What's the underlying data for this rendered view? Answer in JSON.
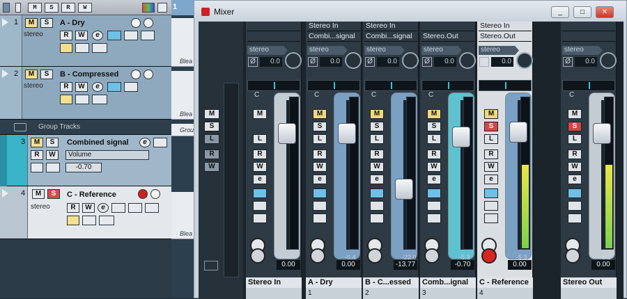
{
  "project": {
    "toolbar": [
      "M",
      "S",
      "R",
      "W"
    ],
    "tracks": [
      {
        "num": "1",
        "name": "A - Dry",
        "sub": "stereo",
        "m": "M",
        "s": "S",
        "r": "R",
        "w": "W",
        "e": "e"
      },
      {
        "num": "2",
        "name": "B - Compressed",
        "sub": "stereo",
        "m": "M",
        "s": "S",
        "r": "R",
        "w": "W",
        "e": "e"
      },
      {
        "folder": "Group Tracks"
      },
      {
        "num": "3",
        "name": "Combined signal",
        "param": "Volume",
        "value": "-0.70",
        "m": "M",
        "s": "S",
        "r": "R",
        "w": "W",
        "e": "e"
      },
      {
        "num": "4",
        "name": "C - Reference",
        "sub": "stereo",
        "m": "M",
        "s": "S",
        "r": "R",
        "w": "W",
        "e": "e"
      }
    ],
    "lanes": [
      "Blea",
      "Blea",
      "Grou",
      "Blea"
    ]
  },
  "mixer": {
    "title": "Mixer",
    "win_min": "_",
    "win_max": "□",
    "win_close": "✕",
    "strips": [
      {
        "routing": [
          "",
          ""
        ],
        "tag": "stereo",
        "gain": "0.0",
        "pan": "C",
        "buttons": [
          "M",
          "",
          "L",
          "R",
          "W",
          "e",
          "",
          "",
          ""
        ],
        "vol": "0.00",
        "peak": "-∞",
        "name": "Stereo In",
        "num": ""
      },
      {
        "routing": [
          "Stereo In",
          "Combi...signal"
        ],
        "tag": "stereo",
        "gain": "0.0",
        "pan": "C",
        "buttons": [
          "M",
          "S",
          "L",
          "R",
          "W",
          "e",
          "",
          "",
          ""
        ],
        "vol": "0.00",
        "peak": "-0.4",
        "name": "A - Dry",
        "num": "1"
      },
      {
        "routing": [
          "Stereo In",
          "Combi...signal"
        ],
        "tag": "stereo",
        "gain": "0.0",
        "pan": "C",
        "buttons": [
          "M",
          "S",
          "L",
          "R",
          "W",
          "e",
          "",
          "",
          ""
        ],
        "vol": "-13.77",
        "peak": "-22.0",
        "name": "B - C...essed",
        "num": "2"
      },
      {
        "routing": [
          "",
          "Stereo.Out"
        ],
        "tag": "stereo",
        "gain": "0.0",
        "pan": "C",
        "buttons": [
          "M",
          "S",
          "L",
          "R",
          "W",
          "e",
          "",
          "",
          ""
        ],
        "vol": "-0.70",
        "peak": "-5.3",
        "name": "Comb...ignal",
        "num": "3"
      },
      {
        "routing": [
          "Stereo In",
          "Stereo.Out"
        ],
        "tag": "stereo",
        "gain": "0.0",
        "pan": "C",
        "buttons": [
          "M",
          "S",
          "L",
          "R",
          "W",
          "e",
          "",
          "",
          ""
        ],
        "vol": "0.00",
        "peak": "-5.3",
        "name": "C - Reference",
        "num": "4"
      },
      {
        "routing": [
          "",
          ""
        ],
        "tag": "stereo",
        "gain": "0.0",
        "pan": "C",
        "buttons": [
          "M",
          "S",
          "L",
          "R",
          "W",
          "e",
          "",
          "",
          ""
        ],
        "vol": "0.00",
        "peak": "-5.3",
        "name": "Stereo Out",
        "num": ""
      }
    ],
    "left_buttons": [
      "M",
      "S",
      "L",
      "R",
      "W"
    ]
  },
  "colors": {
    "accent": "#36c3e0",
    "record": "#cc2222",
    "solo": "#d84545",
    "mute": "#f2d782"
  }
}
